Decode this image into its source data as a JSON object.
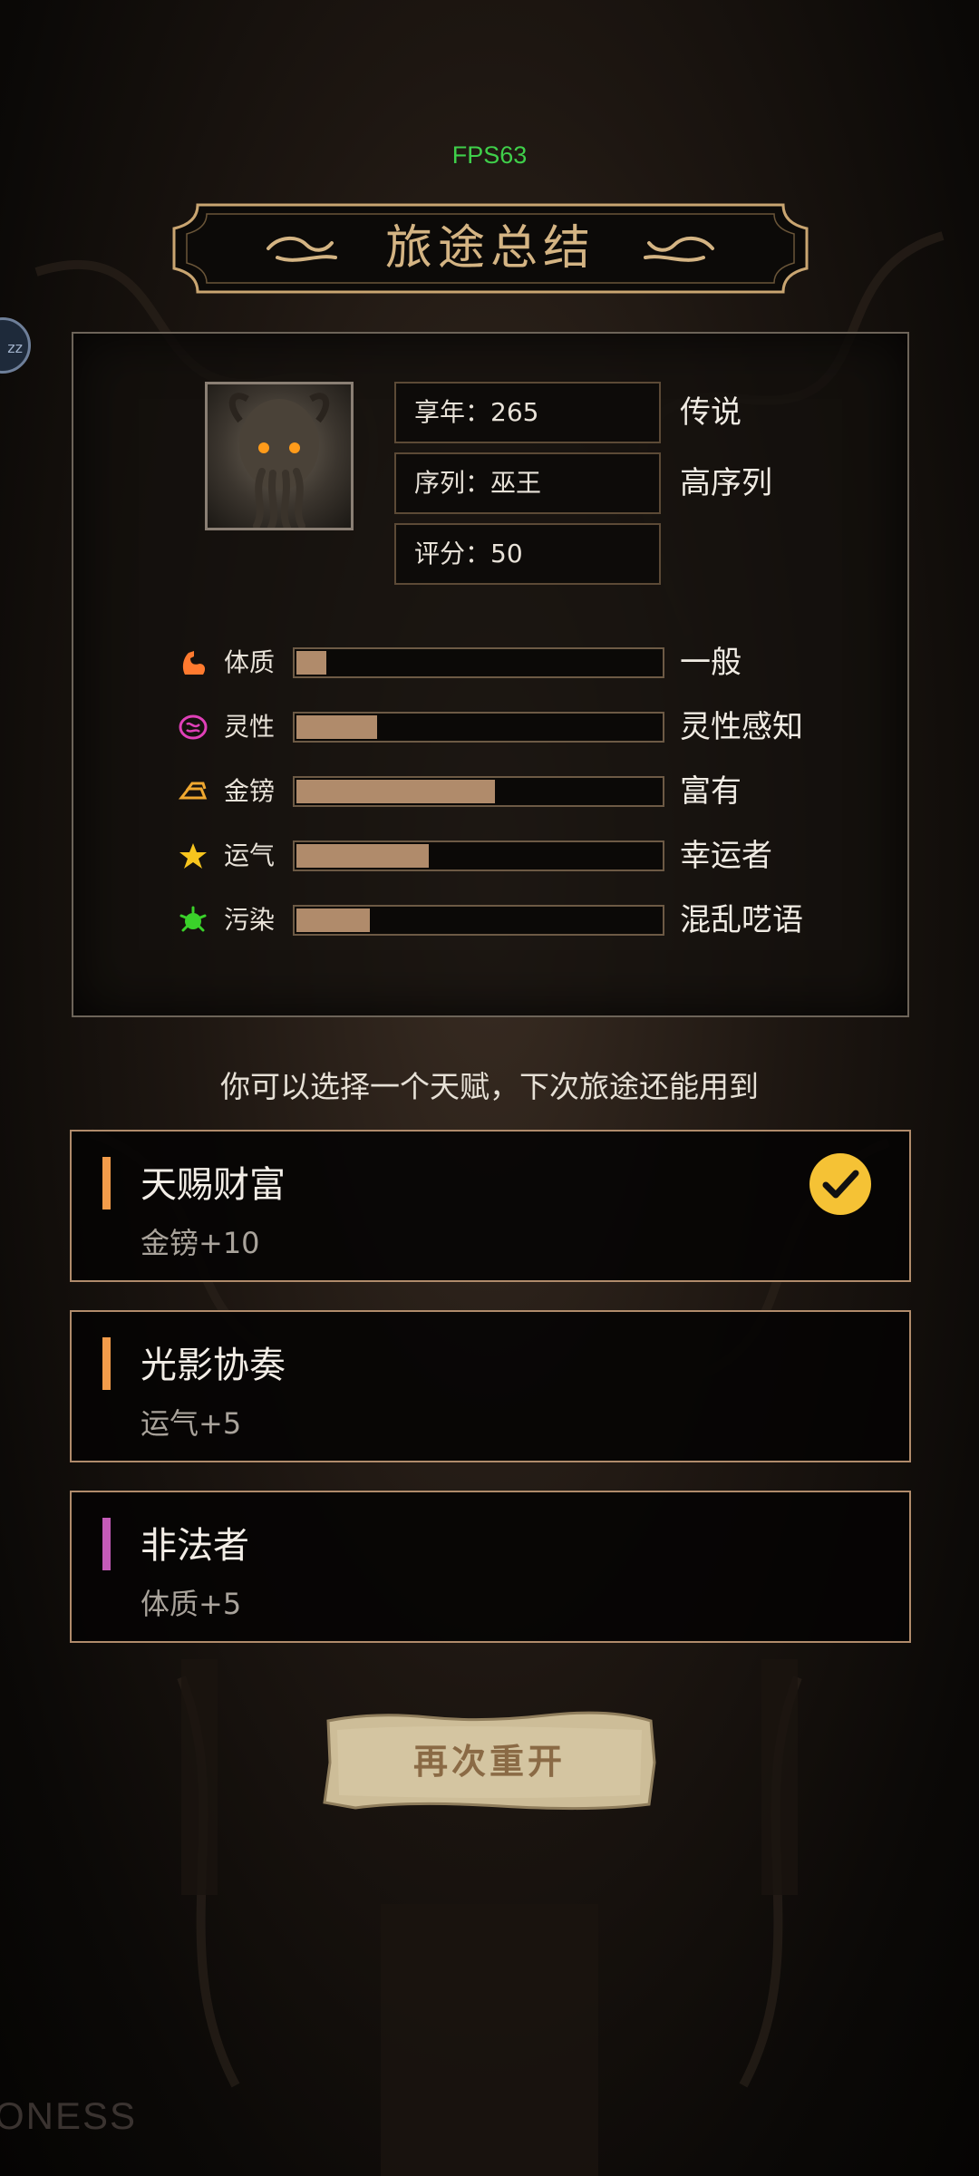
{
  "fps": "FPS63",
  "title": "旅途总结",
  "side_bubble": "zz",
  "colors": {
    "accent": "#d4b483",
    "bar_fill": "#b08b6b",
    "card_border": "#b08b6b",
    "fps_green": "#3fcf4a"
  },
  "portrait": {
    "icon": "cthulhu-portrait"
  },
  "info": [
    {
      "label": "享年：265",
      "tag": "传说"
    },
    {
      "label": "序列：巫王",
      "tag": "高序列"
    },
    {
      "label": "评分：50",
      "tag": ""
    }
  ],
  "stats": [
    {
      "icon": "flexed-arm-icon",
      "label": "体质",
      "fill": 0.09,
      "desc": "一般",
      "color": "#ff7a2f"
    },
    {
      "icon": "brain-icon",
      "label": "灵性",
      "fill": 0.23,
      "desc": "灵性感知",
      "color": "#e040b8"
    },
    {
      "icon": "gold-bars-icon",
      "label": "金镑",
      "fill": 0.55,
      "desc": "富有",
      "color": "#f0a830"
    },
    {
      "icon": "star-icon",
      "label": "运气",
      "fill": 0.37,
      "desc": "幸运者",
      "color": "#f7c51e"
    },
    {
      "icon": "germ-icon",
      "label": "污染",
      "fill": 0.21,
      "desc": "混乱呓语",
      "color": "#3ad12a"
    }
  ],
  "hint": "你可以选择一个天赋，下次旅途还能用到",
  "talents": [
    {
      "name": "天赐财富",
      "effect": "金镑+10",
      "bar_color": "#f39c4a",
      "selected": true
    },
    {
      "name": "光影协奏",
      "effect": "运气+5",
      "bar_color": "#f39c4a",
      "selected": false
    },
    {
      "name": "非法者",
      "effect": "体质+5",
      "bar_color": "#c45bb8",
      "selected": false
    }
  ],
  "restart_label": "再次重开",
  "watermark": "ONESS"
}
